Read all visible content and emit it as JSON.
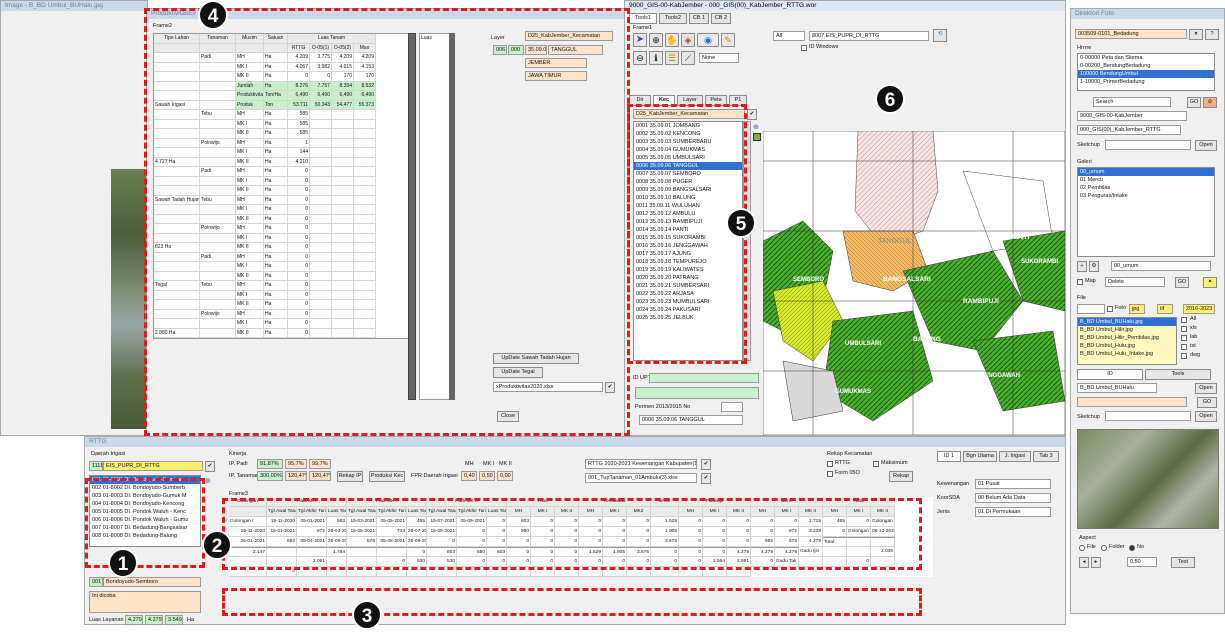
{
  "image_title": "Image - B_BD Umbul_BUHalu.jpg",
  "prod_title": "ProduktivitasEv",
  "frame2_label": "Frame2",
  "prod_headers": [
    "Tipe Lahan",
    "Tanaman",
    "Musim",
    "Satuan",
    "Luas Tanam"
  ],
  "prod_subheaders": [
    "RTTG",
    "O-05(1)",
    "O-05(2)",
    "Max"
  ],
  "prod_rows": [
    [
      "",
      "Padi",
      "MH",
      "Ha",
      "4.209",
      "3.775",
      "4.209",
      "4.209"
    ],
    [
      "",
      "",
      "MK I",
      "Ha",
      "4.067",
      "3.982",
      "4.015",
      "4.153"
    ],
    [
      "",
      "",
      "MK II",
      "Ha",
      "0",
      "0",
      "170",
      "170"
    ],
    [
      "",
      "",
      "Jumlah",
      "Ha",
      "8.276",
      "7.757",
      "8.394",
      "8.532"
    ],
    [
      "",
      "",
      "Produktivitas",
      "Ton/Ha",
      "6,490",
      "6,490",
      "6,490",
      "6,490"
    ],
    [
      "Sawah Irigasi",
      "",
      "Produk",
      "Ton",
      "53.711",
      "50.343",
      "54.477",
      "55.373"
    ],
    [
      "",
      "Tebu",
      "MH",
      "Ha",
      "585",
      "",
      "",
      ""
    ],
    [
      "",
      "",
      "MK I",
      "Ha",
      "585",
      "",
      "",
      ""
    ],
    [
      "",
      "",
      "MK II",
      "Ha",
      "585",
      "",
      "",
      ""
    ],
    [
      "",
      "Polowijo",
      "MH",
      "Ha",
      "1",
      "",
      "",
      ""
    ],
    [
      "",
      "",
      "MK I",
      "Ha",
      "144",
      "",
      "",
      ""
    ],
    [
      "4.727 Ha",
      "",
      "MK II",
      "Ha",
      "4.210",
      "",
      "",
      ""
    ],
    [
      "",
      "Padi",
      "MH",
      "Ha",
      "0",
      "",
      "",
      ""
    ],
    [
      "",
      "",
      "MK I",
      "Ha",
      "0",
      "",
      "",
      ""
    ],
    [
      "",
      "",
      "MK II",
      "Ha",
      "0",
      "",
      "",
      ""
    ],
    [
      "Sawah Tadah Hujan",
      "Tebu",
      "MH",
      "Ha",
      "0",
      "",
      "",
      ""
    ],
    [
      "",
      "",
      "MK I",
      "Ha",
      "0",
      "",
      "",
      ""
    ],
    [
      "",
      "",
      "MK II",
      "Ha",
      "0",
      "",
      "",
      ""
    ],
    [
      "",
      "Polowijo",
      "MH",
      "Ha",
      "0",
      "",
      "",
      ""
    ],
    [
      "",
      "",
      "MK I",
      "Ha",
      "0",
      "",
      "",
      ""
    ],
    [
      "823 Ha",
      "",
      "MK II",
      "Ha",
      "0",
      "",
      "",
      ""
    ],
    [
      "",
      "Padi",
      "MH",
      "Ha",
      "0",
      "",
      "",
      ""
    ],
    [
      "",
      "",
      "MK I",
      "Ha",
      "0",
      "",
      "",
      ""
    ],
    [
      "",
      "",
      "MK II",
      "Ha",
      "0",
      "",
      "",
      ""
    ],
    [
      "Tegal",
      "Tebu",
      "MH",
      "Ha",
      "0",
      "",
      "",
      ""
    ],
    [
      "",
      "",
      "MK I",
      "Ha",
      "0",
      "",
      "",
      ""
    ],
    [
      "",
      "",
      "MK II",
      "Ha",
      "0",
      "",
      "",
      ""
    ],
    [
      "",
      "Polowijo",
      "MH",
      "Ha",
      "0",
      "",
      "",
      ""
    ],
    [
      "",
      "",
      "MK I",
      "Ha",
      "0",
      "",
      "",
      ""
    ],
    [
      "2.880 Ha",
      "",
      "MK II",
      "Ha",
      "0",
      "",
      "",
      ""
    ]
  ],
  "luas_label": "Luas",
  "layer_label": "Layer",
  "layer_value": "D25_KabJember_Kecamatan",
  "layer_rows": [
    [
      "006",
      "000",
      "35.09.0",
      "TANGGUL"
    ],
    [
      "",
      "",
      "",
      "JEMBER"
    ],
    [
      "",
      "",
      "",
      "JAWA TIMUR"
    ]
  ],
  "btn_update_sth": "UpDate Sawah Tadah Hujan",
  "btn_update_tegal": "UpDate Tegal",
  "file_select": "xProduktivitas2020.xlsx",
  "btn_close": "Close",
  "gis_title": "9000_GIS-00-KabJember - 000_GIS(00)_KabJember_RTTG.wor",
  "tools_tabs": [
    "Tools1",
    "Tools2",
    "CB 1",
    "CB 2"
  ],
  "frame1_label": "Frame1",
  "none_select": "None",
  "gis_top_all": "All",
  "gis_top_layer": "8007 EIS_PUPR_DI_RTTG",
  "gis_id_windows": "ID Windows",
  "dir_tabs": [
    "Dir",
    "Kec",
    "Layer",
    "Peta",
    "P1"
  ],
  "kec_select": "D25_KabJember_Kecamatan",
  "kec_list": [
    "0001 35.09.01 JOMBANG",
    "0002 35.09.02 KENCONG",
    "0003 35.09.03 SUMBERBARU",
    "0004 35.09.04 GUMUKMAS",
    "0005 35.09.05 UMBULSARI",
    "0006 35.09.06 TANGGUL",
    "0007 35.09.07 SEMBORO",
    "0008 35.09.08 PUGER",
    "0009 35.09.09 BANGSALSARI",
    "0010 35.09.10 BALUNG",
    "0011 35.09.11 WULUHAN",
    "0012 35.09.12 AMBULU",
    "0013 35.09.13 RAMBIPUJI",
    "0014 35.09.14 PANTI",
    "0015 35.09.15 SUKORAMBI",
    "0016 35.09.16 JENGGAWAH",
    "0017 35.09.17 AJUNG",
    "0018 35.09.18 TEMPUREJO",
    "0019 35.09.19 KALIWATES",
    "0020 35.09.20 PATRANG",
    "0021 35.09.21 SUMBERSARI",
    "0022 35.09.22 ARJASA",
    "0023 35.09.23 MUMBULSARI",
    "0024 35.09.24 PAKUSARI",
    "0025 35.09.25 JELBUK"
  ],
  "kec_selected_index": 5,
  "id_upt_label": "ID UPT",
  "permen_label": "Permen 2013/2015 No",
  "kec_footer": "0006 35.09.06 TANGGUL",
  "map_labels": [
    "TANGGUL",
    "PANTI",
    "SUKORAMBI",
    "BANGSALSARI",
    "RAMBIPUJI",
    "BALUNG",
    "UMBULSARI",
    "SEMBORO",
    "GUMUKMAS",
    "JENGGAWAH"
  ],
  "right_title": "Direktori Foto",
  "right_select": "003509-0101_Bedadung",
  "hirarki_label": "Hrrrre",
  "hirarki_list": [
    "0-00000 Peta dan Skema",
    "0-00200_BendungBedadung",
    "100000 BendungUmbul",
    "1-10000_PrimerBedadung"
  ],
  "hirarki_selected_index": 2,
  "search_select": "Search",
  "go_label": "GO",
  "path1": "9000_GIS-00-KabJember",
  "path2": "000_GIS(00)_KabJember_RTTG",
  "sketchup_label": "Sketchup",
  "open_label": "Open",
  "galeri_label": "Galeri",
  "galeri_list": [
    "00_umum",
    "01 Mercu",
    "02 Pembilas",
    "03 Penguras/Intake"
  ],
  "galeri_selected_index": 0,
  "galeri_input": "00_umum",
  "map_check": "Map",
  "delete_select": "Delete",
  "file_label": "File",
  "file_checks": [
    "Foto",
    "jpg",
    "tif",
    "2016-2023"
  ],
  "file_list": [
    "B_BD Umbul_BUHalu.jpg",
    "B_BD Umbul_Hilir.jpg",
    "B_BD Umbul_Hilir_Pembilas.jpg",
    "B_BD Umbul_Hulu.jpg",
    "B_BD Umbul_Hulu_Intake.jpg"
  ],
  "file_selected_index": 0,
  "file_side_checks": [
    "All",
    "xls",
    "lab",
    "txt",
    "dwg"
  ],
  "id_tabs": [
    "ID",
    "Tools"
  ],
  "id_field": "B_BD Umbul_BUHalu",
  "aspect_label": "Aspect",
  "radio_labels": [
    "File",
    "Folder",
    "No"
  ],
  "zoom_select": "0.50",
  "text_btn": "Text",
  "bottom_title": "RTTG",
  "daerah_irigasi": "Daerah Irigasi",
  "di_code": "1111",
  "di_name": "EIS_PUPR_DI_RTTG",
  "di_list": [
    "001 01-8001 DI. Bondoyudo-Semboro",
    "002 01-8002 DI. Bondoyudo-Sumberb",
    "003 01-8003 DI. Bondoyudo-Gumuk M",
    "004 01-8004 DI. Bondoyudo-Kencong",
    "005 01-8005 DI. Pondok Waluh - Kenc",
    "006 01-8006 DI. Pondok Waluh - Gumu",
    "007 01-8007 DI. Bedadung-Bangsalsar",
    "008 01-8008 DI. Bedadung-Balung"
  ],
  "di_selected_index": 0,
  "di_selected_text": "Bondoyudo-Semboro",
  "di_code2": "001",
  "di_note": "Ini dicoba",
  "luas_layanan_label": "Luas Layanan",
  "luas_layanan_values": [
    "4.279",
    "4.279",
    "3.549"
  ],
  "ha_label": "Ha",
  "kinerja_label": "Kinerja",
  "kinerja_rows": [
    [
      "IP. Padi",
      "91,87%",
      "95,7%",
      "99,7%"
    ],
    [
      "IP. Tanaman",
      "300,00%",
      "120,47%",
      "120,47%"
    ]
  ],
  "rekap_ip": "Rekap IP",
  "produksi_kec": "Produksi Kec",
  "fpr_label": "FPR Daerah Irigasi",
  "fpr_headers": [
    "MH",
    "MK I",
    "MK II"
  ],
  "fpr_values": [
    "0,40",
    "0,50",
    "0,00"
  ],
  "rttg_select": "RTTG 2020-2021 Kewenangan Kabupaten(18).xl",
  "tup_select": "001_TupTanaman_01Ambulu(3).xlsx",
  "rekap_kec": "Rekap Kecamatan",
  "rttg_check": "RTTG",
  "maksimum_check": "Maksimum",
  "form05o": "Form 05O",
  "rekap_btn": "Rekap",
  "side_tabs": [
    "ID 1",
    "Bgn Utama",
    "J. Irigasi",
    "Tab 3"
  ],
  "kewenangan_label": "Kewenangan",
  "kewenangan_val": "01 Pusat",
  "koorsda_label": "KoorSDA",
  "koorsda_val": "00 Belum Ada Data",
  "jenis_label": "Jenis",
  "jenis_val": "01 Di Permukaan",
  "frame3_label": "Frame3",
  "gol_groups": [
    "Golongan",
    "Padi-MH",
    "Padi-MK I",
    "Padi-MK II",
    "Tebu",
    "Tembakau",
    "Jeruk",
    "Polowijo",
    "Bero",
    "Total"
  ],
  "gol_sub": [
    "Tgl.Awal Tanam",
    "Tgl.Akhir Tanam",
    "Luas Tanam",
    "Tgl.Awal Tanam",
    "Tgl.Akhir Tanam",
    "Luas Tanam",
    "Tgl.Awal Tanam",
    "Tgl.Akhir Tanam",
    "Luas Tanam",
    "MH",
    "MK I",
    "MK II",
    "MH",
    "MK I",
    "MK2",
    "",
    "MH",
    "MK I",
    "MK II",
    "MH",
    "MK I",
    "MK II",
    "MH",
    "MK I",
    "MK II"
  ],
  "gol_rows": [
    [
      "Golongan I",
      "15-11-2020",
      "05-01-2021",
      "583",
      "15-03-2021",
      "05-05-2021",
      "465",
      "15-07-2021",
      "05-09-2021",
      "0",
      "603",
      "0",
      "0",
      "0",
      "0",
      "0",
      "1.529",
      "0",
      "0",
      "0",
      "0",
      "0",
      "2.715",
      "465",
      "0"
    ],
    [
      "Golongan II",
      "25-11-2020",
      "15-01-2021",
      "872",
      "25-03-2021",
      "15-05-2021",
      "743",
      "25-07-2021",
      "15-09-2021",
      "0",
      "0",
      "580",
      "0",
      "0",
      "0",
      "0",
      "0",
      "1.905",
      "0",
      "0",
      "0",
      "0",
      "872",
      "3.238",
      "0"
    ],
    [
      "Golongan III",
      "05-12-2020",
      "25-01-2021",
      "692",
      "05-04-2021",
      "25-05-2021",
      "576",
      "05-08-2021",
      "25-09-2021",
      "0",
      "0",
      "0",
      "0",
      "0",
      "0",
      "0",
      "0",
      "0",
      "3.676",
      "0",
      "0",
      "0",
      "692",
      "576",
      "4.279"
    ]
  ],
  "total_row": [
    "Total",
    "",
    "",
    "2.147",
    "",
    "",
    "1.784",
    "",
    "",
    "0",
    "603",
    "580",
    "603",
    "0",
    "0",
    "0",
    "1.529",
    "1.905",
    "3.676",
    "0",
    "0",
    "0",
    "4.279",
    "4.279",
    "4.279"
  ],
  "gadu_rows": [
    [
      "Gadu Ijin",
      "",
      "",
      "2.036",
      "",
      "",
      "2.061",
      "",
      "",
      "0",
      "530",
      "530",
      "0",
      "0",
      "0",
      "0",
      "0",
      "0",
      "0",
      "0",
      "0",
      "0",
      "2.564",
      "2.591",
      "0"
    ],
    [
      "Gadu Tak Ijin",
      "",
      "",
      "0",
      "",
      "",
      "0",
      "",
      "",
      "",
      "",
      "",
      "",
      "",
      "",
      "",
      "",
      "",
      "",
      "",
      "",
      "",
      "",
      "",
      ""
    ]
  ],
  "badges": [
    "1",
    "2",
    "3",
    "4",
    "5",
    "6"
  ]
}
